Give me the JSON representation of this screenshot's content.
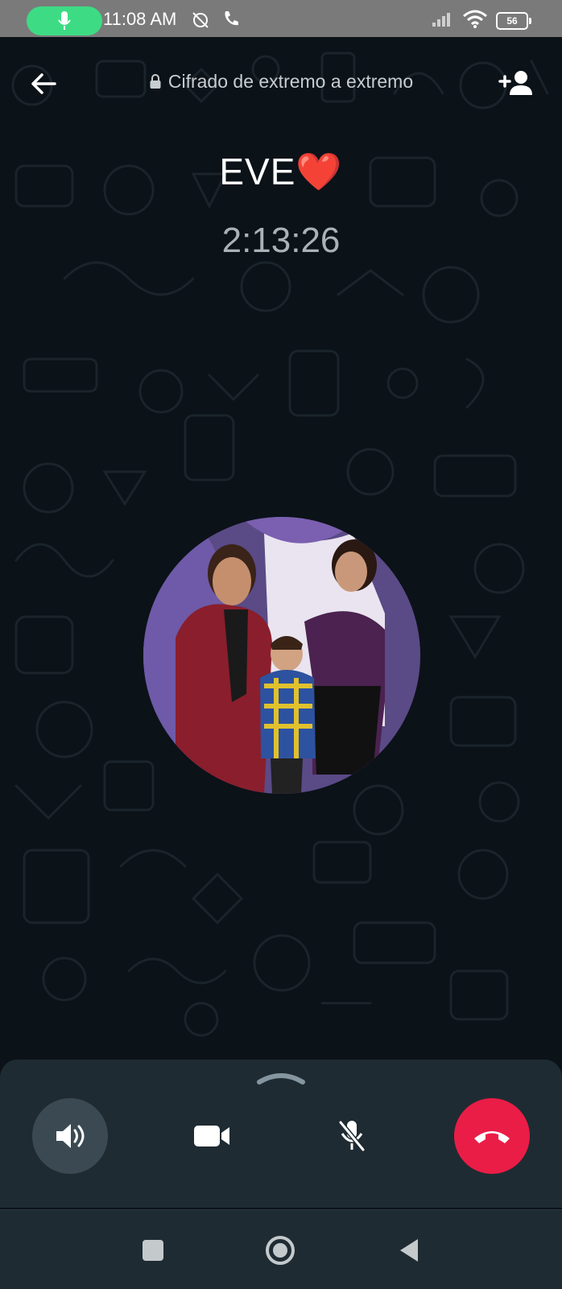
{
  "status_bar": {
    "time": "11:08 AM",
    "battery": "56",
    "icons": [
      "mic-icon",
      "alarm-off-icon",
      "phone-icon",
      "signal-icon",
      "wifi-icon",
      "battery-icon"
    ]
  },
  "header": {
    "encryption_text": "Cifrado de extremo a extremo",
    "icons": [
      "back-arrow-icon",
      "lock-icon",
      "add-person-icon"
    ]
  },
  "call": {
    "contact_name": "EVE❤️",
    "duration": "2:13:26"
  },
  "controls": {
    "icons": [
      "speaker-icon",
      "video-camera-icon",
      "mic-off-icon",
      "end-call-icon"
    ],
    "speaker_active": true
  },
  "nav": {
    "icons": [
      "recents-square-icon",
      "home-circle-icon",
      "back-triangle-icon"
    ]
  },
  "colors": {
    "background": "#0b1218",
    "end_call": "#ea1d47",
    "mic_pill": "#3ddc84",
    "sheet": "#1f2b32"
  }
}
